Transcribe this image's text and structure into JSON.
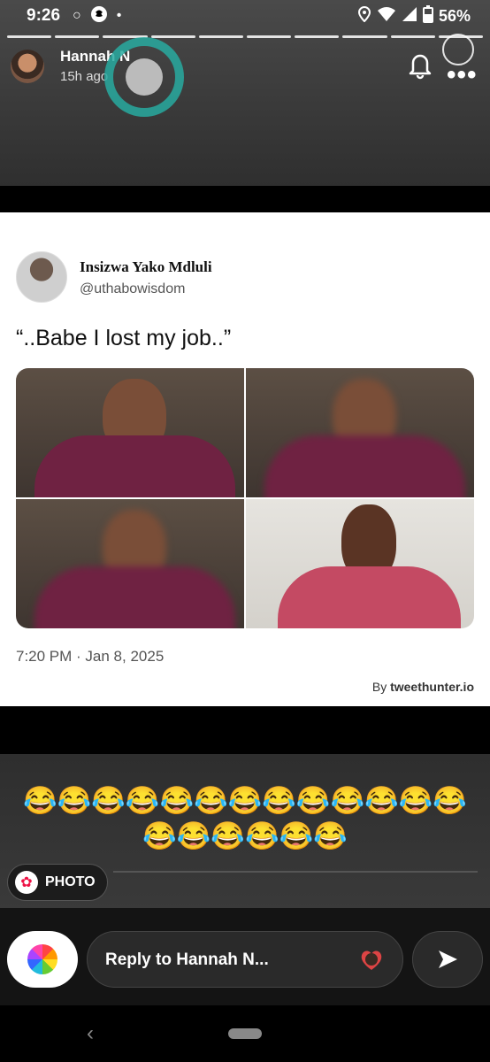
{
  "status_bar": {
    "time": "9:26",
    "battery": "56%",
    "left_icons": [
      "circle-icon",
      "snapchat-icon",
      "dot-icon"
    ],
    "right_icons": [
      "location-icon",
      "wifi-icon",
      "signal-icon",
      "battery-icon"
    ]
  },
  "story": {
    "user_name": "Hannah N",
    "time_ago": "15h ago",
    "progress_segments": 10
  },
  "tweet": {
    "author_name": "Insizwa Yako Mdluli",
    "handle": "@uthabowisdom",
    "text": "“..Babe I lost my job..”",
    "date": "7:20 PM · Jan 8, 2025",
    "by_prefix": "By ",
    "by_brand": "tweethunter.io"
  },
  "caption": {
    "line1": "😂😂😂😂😂😂😂😂😂😂😂😂😂",
    "line2": "😂😂😂😂😂😂"
  },
  "photo_chip": {
    "label": "PHOTO"
  },
  "reply": {
    "placeholder": "Reply to Hannah N..."
  },
  "colors": {
    "accent_ring": "#28aaa0",
    "tweet_bg": "#ffffff",
    "reply_bar": "#141414"
  }
}
